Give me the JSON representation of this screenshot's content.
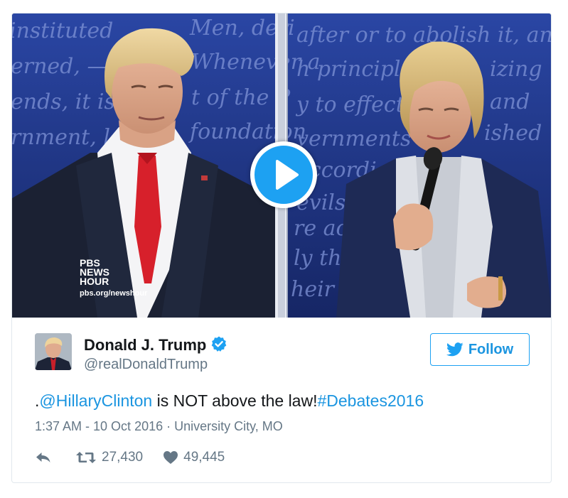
{
  "media": {
    "backdrop_lines": [
      "instituted",
      "Men, deri",
      "after or to abolish it, and to",
      "erned, —",
      "Whenever a",
      "h principle",
      "izing",
      "ends, it is",
      "t of the P",
      "y to effect",
      "and",
      "rnment, la",
      "foundation",
      "vernments lo",
      "ished",
      "accordi",
      "evils",
      "re accu",
      "ly the",
      "heir r"
    ],
    "watermark": {
      "logo_text": "PBS NEWS HOUR",
      "url": "pbs.org/newshour"
    },
    "play_icon": "play-icon",
    "colors": {
      "play_button": "#1da1f2",
      "backdrop": "#1d2f7a"
    }
  },
  "header": {
    "display_name": "Donald J. Trump",
    "screen_name": "@realDonaldTrump",
    "verified_icon": "verified-badge-icon",
    "follow_label": "Follow"
  },
  "tweet": {
    "prefix": ".",
    "mention": "@HillaryClinton",
    "body": " is NOT above the law!",
    "hashtag": "#Debates2016"
  },
  "metadata": {
    "timestamp": "1:37 AM - 10 Oct 2016",
    "separator": " · ",
    "location": "University City, MO"
  },
  "actions": {
    "retweet_count": "27,430",
    "like_count": "49,445"
  },
  "colors": {
    "link": "#1b95e0",
    "text": "#14171a",
    "muted": "#657786",
    "border": "#e1e8ed"
  }
}
